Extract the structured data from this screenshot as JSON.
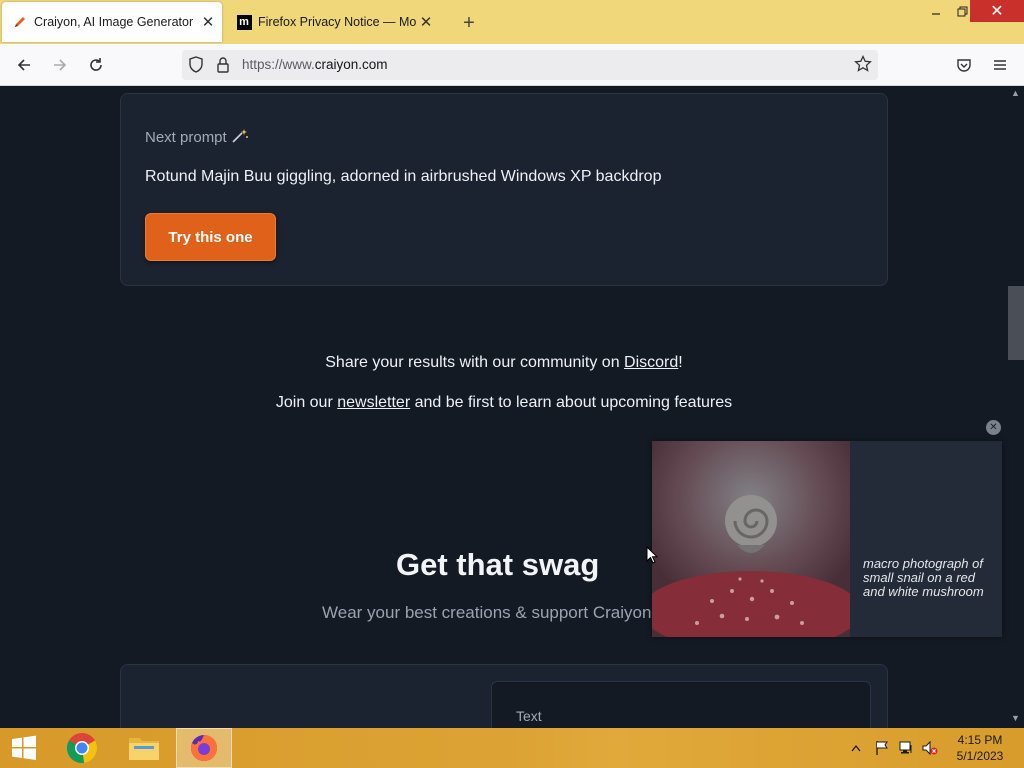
{
  "browser": {
    "tabs": [
      {
        "title": "Craiyon, AI Image Generator",
        "favicon": "pencil-icon",
        "active": true
      },
      {
        "title": "Firefox Privacy Notice — Mozilla",
        "favicon": "m",
        "active": false
      }
    ],
    "new_tab": "+",
    "url_scheme": "https://www.",
    "url_host": "craiyon.com"
  },
  "page": {
    "next_prompt_label": "Next prompt",
    "next_prompt_text": "Rotund Majin Buu giggling, adorned in airbrushed Windows XP backdrop",
    "try_button": "Try this one",
    "share_prefix": "Share your results with our community on ",
    "share_link": "Discord",
    "share_suffix": "!",
    "join_prefix": "Join our ",
    "join_link": "newsletter",
    "join_suffix": " and be first to learn about upcoming features",
    "swag_title": "Get that swag",
    "swag_subtitle": "Wear your best creations & support Craiyon",
    "bottom_text": "Text"
  },
  "overlay": {
    "caption": "macro photograph of small snail on a red and white mushroom"
  },
  "taskbar": {
    "time": "4:15 PM",
    "date": "5/1/2023"
  },
  "colors": {
    "accent_button": "#e0621a",
    "page_bg": "#141a24",
    "taskbar": "#dca334",
    "tabstrip": "#f0d77a"
  }
}
